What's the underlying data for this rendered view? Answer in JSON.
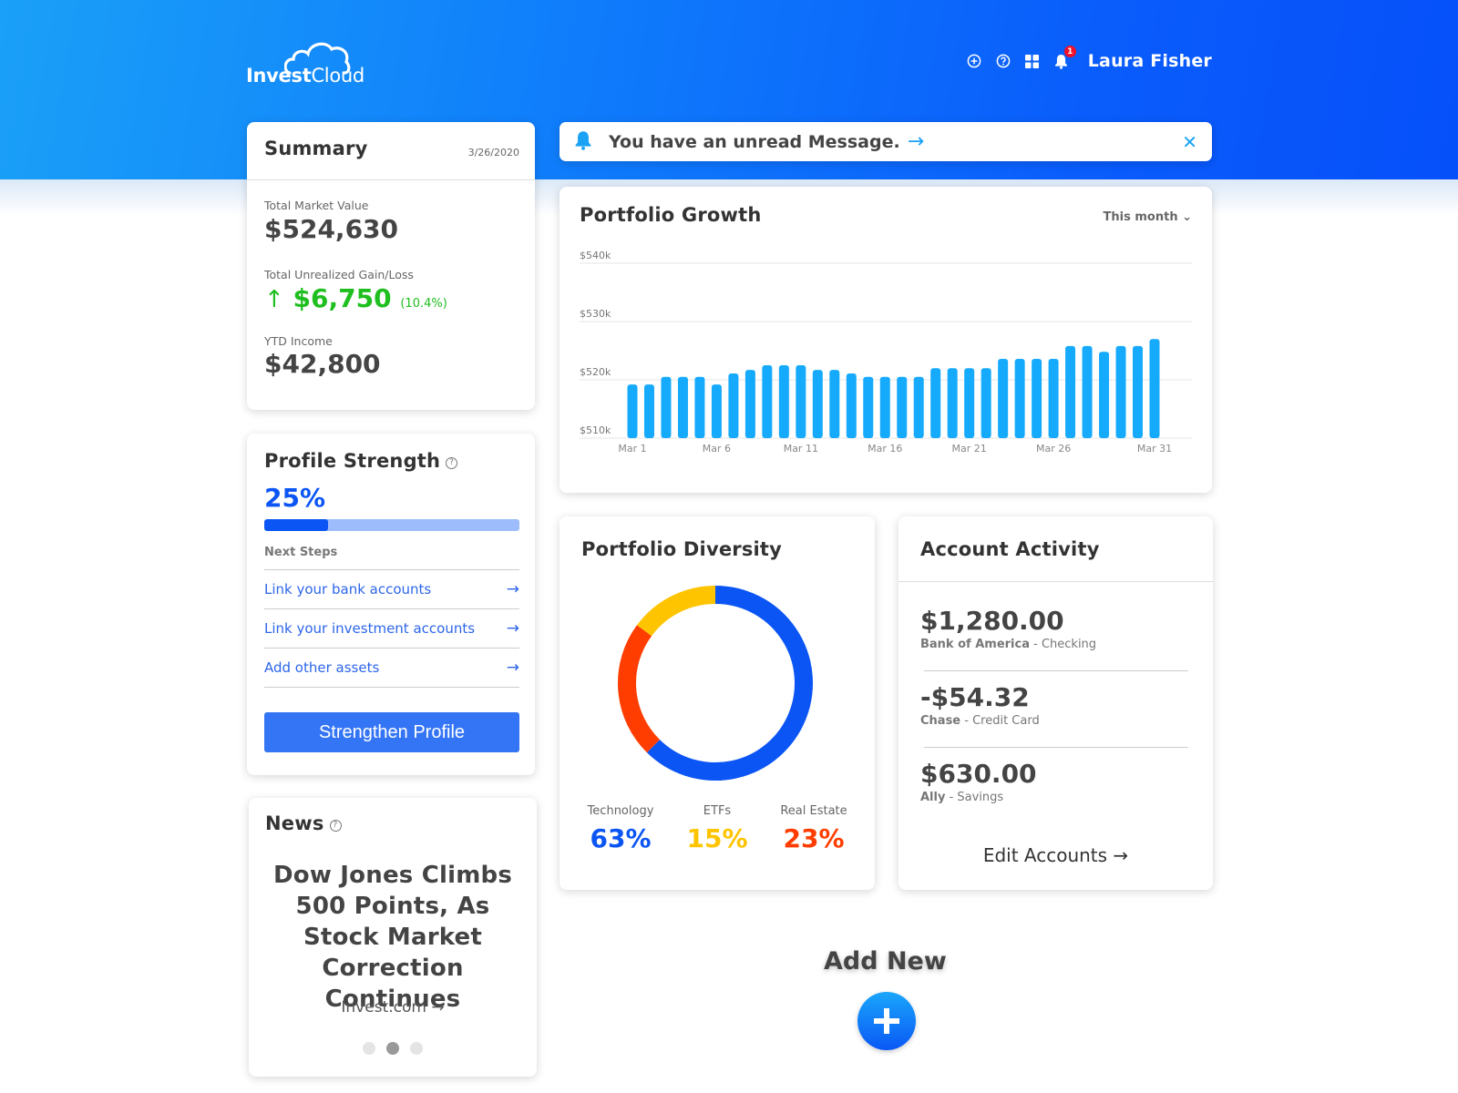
{
  "header": {
    "logo_bold": "Invest",
    "logo_light": "Cloud",
    "nav_icons": [
      "plus-circle-icon",
      "help-icon",
      "apps-grid-icon",
      "bell-icon"
    ],
    "notification_count": "1",
    "user_name": "Laura Fisher"
  },
  "summary": {
    "title": "Summary",
    "date": "3/26/2020",
    "market_value_label": "Total Market Value",
    "market_value": "$524,630",
    "gain_label": "Total Unrealized Gain/Loss",
    "gain_value": "$6,750",
    "gain_pct": "(10.4%)",
    "gain_arrow": "↑",
    "ytd_label": "YTD Income",
    "ytd_value": "$42,800"
  },
  "profile": {
    "title": "Profile Strength",
    "help": "?",
    "percent_label": "25%",
    "progress": 0.25,
    "next_steps_label": "Next Steps",
    "steps": [
      {
        "label": "Link your bank accounts",
        "arrow": "→"
      },
      {
        "label": "Link your investment accounts",
        "arrow": "→"
      },
      {
        "label": "Add other assets",
        "arrow": "→"
      }
    ],
    "button_label": "Strengthen Profile"
  },
  "news": {
    "title": "News",
    "help": "?",
    "headline": "Dow Jones Climbs 500 Points, As Stock Market Correction Continues",
    "source": "Invest.com →",
    "active_slide": 1,
    "slide_count": 3
  },
  "notification": {
    "text": "You have an unread Message.",
    "arrow": "→",
    "close": "✕"
  },
  "growth": {
    "title": "Portfolio Growth",
    "range_label": "This month ⌄"
  },
  "diversity": {
    "title": "Portfolio Diversity",
    "items": [
      {
        "label": "Technology",
        "value": "63%",
        "color": "#0b55f5"
      },
      {
        "label": "ETFs",
        "value": "15%",
        "color": "#ffc400"
      },
      {
        "label": "Real Estate",
        "value": "23%",
        "color": "#ff3d00"
      }
    ]
  },
  "activity": {
    "title": "Account Activity",
    "accounts": [
      {
        "amount": "$1,280.00",
        "institution": "Bank of America",
        "type": " - Checking"
      },
      {
        "amount": "-$54.32",
        "institution": "Chase",
        "type": " - Credit Card"
      },
      {
        "amount": "$630.00",
        "institution": "Ally",
        "type": " - Savings"
      }
    ],
    "edit_label": "Edit Accounts →"
  },
  "add_new": {
    "label": "Add New"
  },
  "colors": {
    "accent": "#0b55f5",
    "bar": "#16aafc",
    "gain": "#1fbf1f"
  },
  "chart_data": [
    {
      "type": "bar",
      "title": "Portfolio Growth",
      "xlabel": "",
      "ylabel": "",
      "ylim": [
        510,
        540
      ],
      "yticks": [
        510,
        520,
        530,
        540
      ],
      "ytick_labels": [
        "$510k",
        "$520k",
        "$530k",
        "$540k"
      ],
      "grid": true,
      "x_tick_labels": [
        "Mar 1",
        "Mar 6",
        "Mar 11",
        "Mar 16",
        "Mar 21",
        "Mar 26",
        "Mar 31"
      ],
      "x_tick_indices": [
        0,
        5,
        10,
        15,
        20,
        25,
        31
      ],
      "values": [
        519.2,
        519.2,
        520.5,
        520.5,
        520.5,
        519.2,
        521.1,
        521.7,
        522.5,
        522.5,
        522.5,
        521.7,
        521.7,
        521.1,
        520.5,
        520.5,
        520.5,
        520.5,
        522.0,
        522.0,
        522.0,
        522.0,
        523.6,
        523.6,
        523.6,
        523.6,
        525.8,
        525.8,
        524.8,
        525.8,
        525.8,
        527.0
      ],
      "units": "$k"
    },
    {
      "type": "pie",
      "title": "Portfolio Diversity",
      "categories": [
        "Technology",
        "ETFs",
        "Real Estate"
      ],
      "values": [
        63,
        15,
        23
      ],
      "colors": [
        "#0b55f5",
        "#ffc400",
        "#ff3d00"
      ],
      "donut": true,
      "order_clockwise_from_top": [
        "Technology",
        "Real Estate",
        "ETFs"
      ]
    }
  ]
}
